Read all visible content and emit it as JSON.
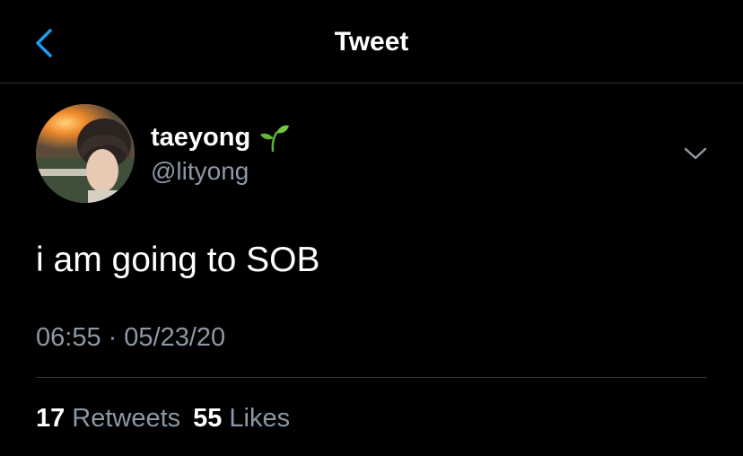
{
  "header": {
    "title": "Tweet",
    "back_icon": "chevron-left-icon",
    "accent_color": "#1d9bf0"
  },
  "tweet": {
    "author_name": "taeyong",
    "name_emoji_icon": "seedling-icon",
    "author_handle": "@lityong",
    "more_icon": "chevron-down-icon",
    "text": "i am going to SOB",
    "time": "06:55",
    "separator": "·",
    "date": "05/23/20"
  },
  "stats": {
    "retweets_count": "17",
    "retweets_label": "Retweets",
    "likes_count": "55",
    "likes_label": "Likes"
  },
  "colors": {
    "background": "#000000",
    "text_primary": "#ffffff",
    "text_secondary": "#8b98a5",
    "divider": "#2f3336"
  }
}
